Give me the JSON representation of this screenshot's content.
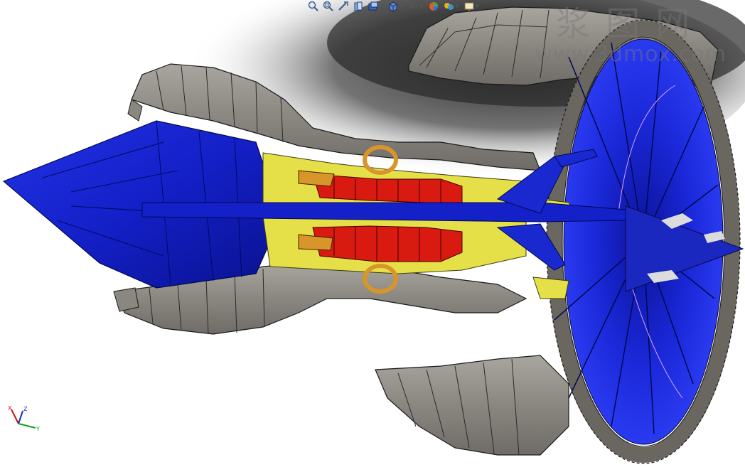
{
  "toolbar": {
    "tools": [
      {
        "name": "zoom-to-fit",
        "icon": "magnifier-fit-icon"
      },
      {
        "name": "zoom-to-area",
        "icon": "magnifier-area-icon"
      },
      {
        "name": "previous-view",
        "icon": "previous-view-icon"
      },
      {
        "name": "section-view",
        "icon": "section-view-icon"
      },
      {
        "name": "dynamic-annotation",
        "icon": "annotation-icon"
      },
      {
        "name": "view-orientation",
        "icon": "cube-view-icon"
      },
      {
        "name": "display-style",
        "icon": "display-style-icon"
      },
      {
        "name": "hide-show-items",
        "icon": "eye-icon"
      },
      {
        "name": "edit-appearance",
        "icon": "appearance-sphere-icon"
      },
      {
        "name": "apply-scene",
        "icon": "scene-icon"
      },
      {
        "name": "view-settings",
        "icon": "monitor-icon"
      }
    ]
  },
  "watermark": {
    "text_cn": "浆图网",
    "url": "www.3dmox.com"
  },
  "triad": {
    "x": "X",
    "y": "Y",
    "z": "Z"
  },
  "colors": {
    "casing": "#8a8680",
    "rotor_blue": "#1420c8",
    "combustor_red": "#d81a10",
    "compressor_yellow": "#e6e048",
    "bearing_orange": "#d8962a",
    "edges": "#1a1a1a"
  }
}
